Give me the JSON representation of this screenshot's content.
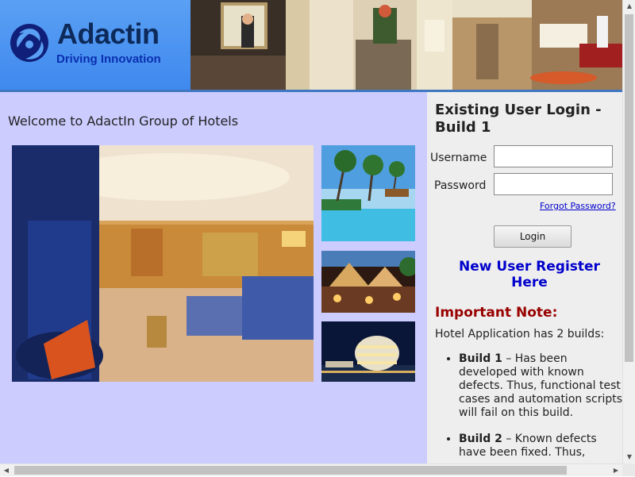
{
  "header": {
    "brand": "Adactin",
    "tagline": "Driving Innovation",
    "logo_icon": "adactin-swirl-icon",
    "brand_color": "#0d2a5a",
    "accent_color": "#3f88ee"
  },
  "main": {
    "welcome": "Welcome to AdactIn Group of Hotels",
    "background_color": "#ccccff",
    "images": [
      "hotel-suite-photo",
      "beach-pool-photo",
      "resort-tents-photo",
      "hotel-night-photo"
    ]
  },
  "login": {
    "title": "Existing User Login - Build 1",
    "username_label": "Username",
    "username_value": "",
    "password_label": "Password",
    "password_value": "",
    "forgot_password": "Forgot Password?",
    "login_button": "Login",
    "register_link": "New User Register Here"
  },
  "note": {
    "title": "Important Note:",
    "intro": "Hotel Application has 2 builds:",
    "builds": [
      {
        "name": "Build 1",
        "text": " – Has been developed with known defects. Thus, functional test cases and automation scripts will fail on this build."
      },
      {
        "name": "Build 2",
        "text": " – Known defects have been fixed. Thus,"
      }
    ]
  },
  "scrollbars": {
    "up_arrow": "▲",
    "down_arrow": "▼",
    "left_arrow": "◀",
    "right_arrow": "▶"
  }
}
